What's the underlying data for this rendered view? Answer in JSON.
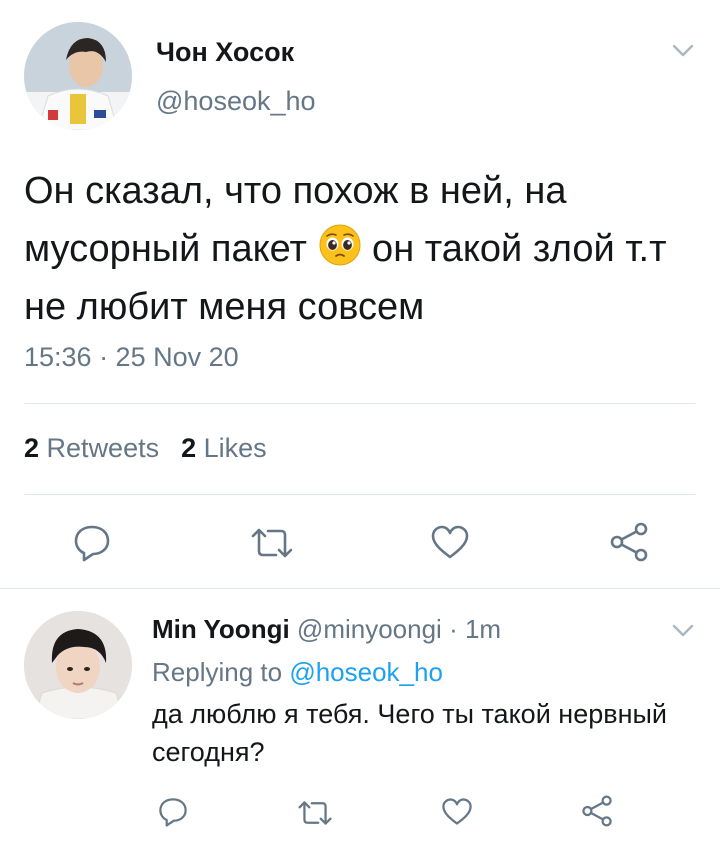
{
  "tweet": {
    "author_name": "Чон Хосок",
    "author_handle": "@hoseok_ho",
    "text_before_emoji": "Он сказал, что похож в ней, на мусорный пакет ",
    "emoji": "pleading-face",
    "text_after_emoji": " он такой злой т.т не любит меня совсем",
    "timestamp": "15:36 · 25 Nov 20",
    "retweets_count": "2",
    "retweets_label": "Retweets",
    "likes_count": "2",
    "likes_label": "Likes"
  },
  "reply": {
    "author_name": "Min Yoongi",
    "author_handle": "@minyoongi",
    "separator": "·",
    "time": "1m",
    "replying_prefix": "Replying to",
    "replying_to": "@hoseok_ho",
    "text": "да люблю я тебя. Чего ты такой нервный сегодня?"
  },
  "icons": {
    "reply": "comment-icon",
    "retweet": "retweet-icon",
    "like": "heart-icon",
    "share": "share-icon",
    "menu": "chevron-down-icon"
  },
  "colors": {
    "text": "#14171a",
    "secondary": "#657786",
    "link": "#1da1f2",
    "divider": "#e1e8ed"
  }
}
